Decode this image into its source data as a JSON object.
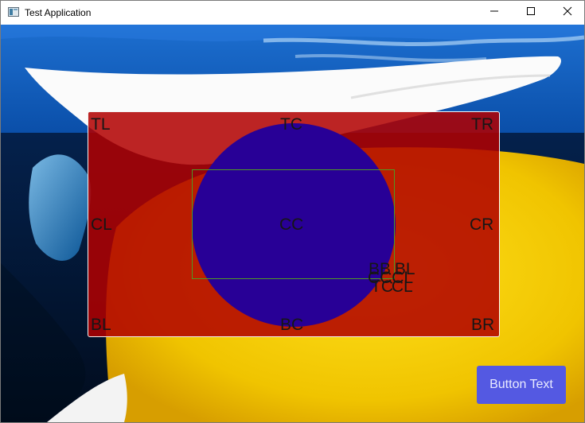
{
  "window": {
    "title": "Test Application",
    "controls": [
      "minimize-icon",
      "maximize-icon",
      "close-icon"
    ]
  },
  "labels": {
    "tl": "TL",
    "tc": "TC",
    "tr": "TR",
    "cl": "CL",
    "cc": "CC",
    "cr": "CR",
    "bl": "BL",
    "bc": "BC",
    "br": "BR",
    "overlap_bbl_1": "BB",
    "overlap_bbl_2": "BL",
    "overlap_ccl_1": "CC",
    "overlap_ccl_2": "CL",
    "overlap_tcl_1": "TC",
    "overlap_tcl_2": "CL"
  },
  "button": {
    "label": "Button Text"
  },
  "colors": {
    "panel": "#b00000",
    "circle": "#280096",
    "inner_rect_border": "#4f9a23",
    "button": "#5459e2",
    "sky": "#0b53b7",
    "yellow_shape": "#f3cb00"
  }
}
